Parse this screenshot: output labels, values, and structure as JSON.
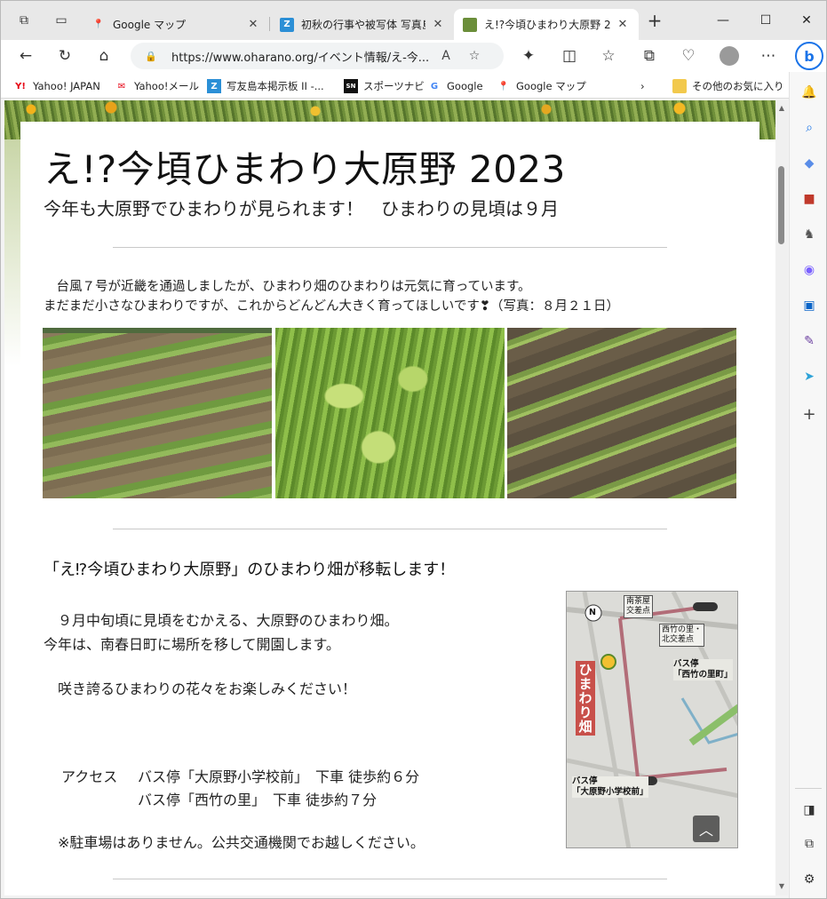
{
  "tabs": [
    {
      "title": "Google マップ",
      "close": "✕",
      "favicon": "map-pin"
    },
    {
      "title": "初秋の行事や被写体 写真島",
      "close": "✕",
      "favicon": "z-logo"
    },
    {
      "title": "え!?今頃ひまわり大原野 2023",
      "close": "✕",
      "favicon": "photo-logo",
      "active": true
    }
  ],
  "new_tab": "+",
  "window_controls": {
    "minimize": "—",
    "maximize": "☐",
    "close": "✕"
  },
  "address": {
    "url_host": "https://www.oharano.org",
    "url_path": "/イベント情報/え-今..."
  },
  "bookmarks": [
    {
      "label": "Yahoo! JAPAN",
      "icon": "Y!"
    },
    {
      "label": "Yahoo!メール",
      "icon": "✉"
    },
    {
      "label": "写友島本掲示板 II -...",
      "icon": "Z"
    },
    {
      "label": "スポーツナビ",
      "icon": "SN"
    },
    {
      "label": "Google",
      "icon": "G"
    },
    {
      "label": "Google マップ",
      "icon": "map"
    },
    {
      "label": "その他のお気に入り",
      "icon": "folder"
    }
  ],
  "page": {
    "title": "え!?今頃ひまわり大原野 2023",
    "subtitle": "今年も大原野でひまわりが見られます！　ひまわりの見頃は９月",
    "para1_line1": "　台風７号が近畿を通過しましたが、ひまわり畑のひまわりは元気に育っています。",
    "para1_line2": "まだまだ小さなひまわりですが、これからどんどん大きく育ってほしいです❣（写真：８月２１日）",
    "section_title": "「え⁉今頃ひまわり大原野」のひまわり畑が移転します！",
    "body1": "　９月中旬頃に見頃をむかえる、大原野のひまわり畑。",
    "body2": "今年は、南春日町に場所を移して開園します。",
    "body3": "　咲き誇るひまわりの花々をお楽しみください！",
    "access_label": "アクセス",
    "access1": "バス停「大原野小学校前」　下車 徒歩約６分",
    "access2": "バス停「西竹の里」　下車 徒歩約７分",
    "parking": "　※駐車場はありません。公共交通機関でお越しください。"
  },
  "map": {
    "north": "N",
    "label_nanchaya": "南茶屋\n交差点",
    "label_nishitake": "西竹の里・\n北交差点",
    "bus_nishitake": "バス停\n「西竹の里町」",
    "bus_school": "バス停\n「大原野小学校前」",
    "field": "ひまわり畑"
  },
  "back_to_top": "︿"
}
